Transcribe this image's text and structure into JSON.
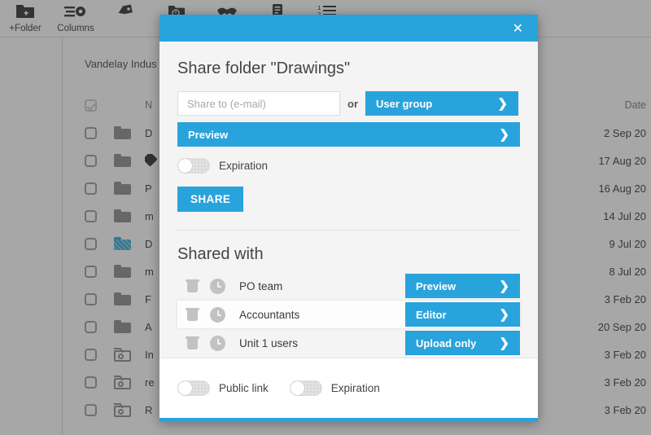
{
  "app": {
    "toolbar_items": [
      {
        "label": "+Folder",
        "icon": "folder-add-icon"
      },
      {
        "label": "Columns",
        "icon": "columns-gear-icon"
      },
      {
        "label": "",
        "icon": "tag-icon"
      },
      {
        "label": "",
        "icon": "folder-clock-icon"
      },
      {
        "label": "",
        "icon": "handshake-icon"
      },
      {
        "label": "",
        "icon": "document-icon"
      },
      {
        "label": "",
        "icon": "numbered-list-icon"
      }
    ],
    "breadcrumb": "Vandelay Indus",
    "table": {
      "columns": {
        "name": "N",
        "date": "Date"
      },
      "rows": [
        {
          "name": "D",
          "icon": "folder-icon",
          "date": "2 Sep 20"
        },
        {
          "name": "",
          "icon": "folder-tag-icon",
          "date": "17 Aug 20"
        },
        {
          "name": "P",
          "icon": "folder-icon",
          "date": "16 Aug 20"
        },
        {
          "name": "m",
          "icon": "folder-icon",
          "date": "14 Jul 20"
        },
        {
          "name": "D",
          "icon": "folder-shared-icon",
          "date": "9 Jul 20"
        },
        {
          "name": "m",
          "icon": "folder-icon",
          "date": "8 Jul 20"
        },
        {
          "name": "F",
          "icon": "folder-icon",
          "date": "3 Feb 20"
        },
        {
          "name": "A",
          "icon": "folder-icon",
          "date": "20 Sep 20"
        },
        {
          "name": "In",
          "icon": "image-search-icon",
          "date": "3 Feb 20"
        },
        {
          "name": "re",
          "icon": "image-search-icon",
          "date": "3 Feb 20"
        },
        {
          "name": "R",
          "icon": "image-search-icon",
          "date": "3 Feb 20"
        }
      ]
    }
  },
  "modal": {
    "close_label": "✕",
    "title": "Share folder \"Drawings\"",
    "email_placeholder": "Share to (e-mail)",
    "email_value": "",
    "or_label": "or",
    "user_group_label": "User group",
    "preview_label": "Preview",
    "chevron": "❯",
    "expiration_label": "Expiration",
    "share_button": "SHARE",
    "shared_with_title": "Shared with",
    "shared_with": [
      {
        "name": "PO team",
        "permission": "Preview"
      },
      {
        "name": "Accountants",
        "permission": "Editor"
      },
      {
        "name": "Unit 1 users",
        "permission": "Upload only"
      }
    ],
    "footer": {
      "public_link_label": "Public link",
      "expiration_label": "Expiration"
    }
  },
  "colors": {
    "accent": "#29a3dc",
    "modal_bg": "#f4f4f4",
    "text": "#444444"
  }
}
